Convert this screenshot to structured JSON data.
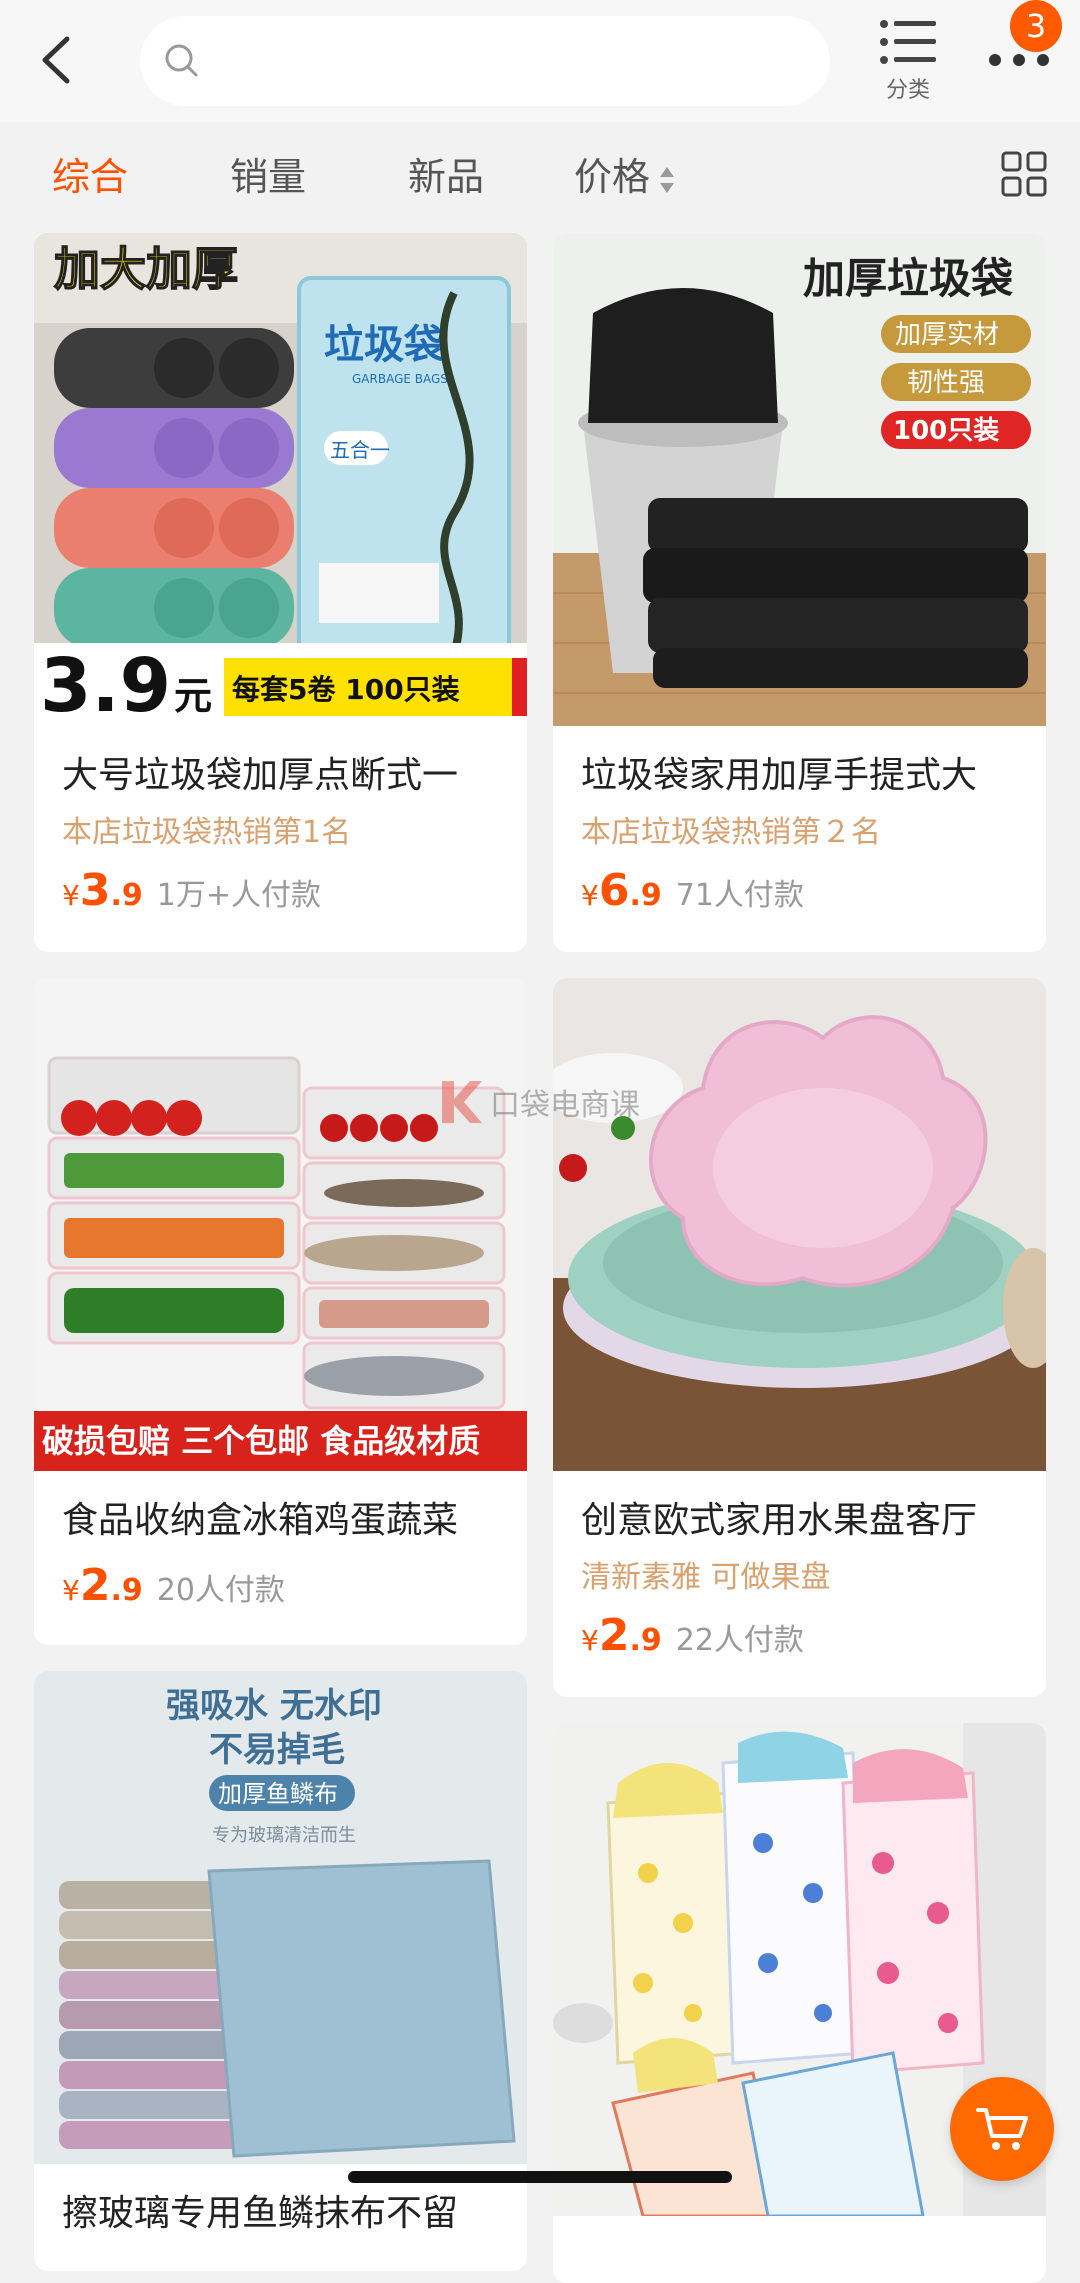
{
  "header": {
    "search_placeholder": "",
    "category_label": "分类",
    "notification_count": "3"
  },
  "sort_tabs": [
    {
      "label": "综合",
      "active": true
    },
    {
      "label": "销量",
      "active": false
    },
    {
      "label": "新品",
      "active": false
    },
    {
      "label": "价格",
      "active": false
    }
  ],
  "products": [
    {
      "title": "大号垃圾袋加厚点断式一",
      "tag": "本店垃圾袋热销第1名",
      "currency": "¥",
      "price_int": "3",
      "price_dec": ".9",
      "sold": "1万+人付款",
      "image": {
        "headline": "加大加厚",
        "package": "垃圾袋",
        "package_en": "GARBAGE BAGS",
        "five_in_one": "五合一",
        "big_price": "3.9",
        "big_price_unit": "元",
        "banner": "每套5卷 100只装"
      }
    },
    {
      "title": "垃圾袋家用加厚手提式大",
      "tag": "本店垃圾袋热销第２名",
      "currency": "¥",
      "price_int": "6",
      "price_dec": ".9",
      "sold": "71人付款",
      "image": {
        "headline": "加厚垃圾袋",
        "badge1": "加厚实材",
        "badge2": "韧性强",
        "badge3": "100只装"
      }
    },
    {
      "title": "食品收纳盒冰箱鸡蛋蔬菜",
      "tag": "",
      "currency": "¥",
      "price_int": "2",
      "price_dec": ".9",
      "sold": "20人付款",
      "image": {
        "banner": "破损包赔 三个包邮 食品级材质"
      }
    },
    {
      "title": "创意欧式家用水果盘客厅",
      "tag": "清新素雅 可做果盘",
      "currency": "¥",
      "price_int": "2",
      "price_dec": ".9",
      "sold": "22人付款",
      "image": {}
    },
    {
      "title": "擦玻璃专用鱼鳞抹布不留",
      "image": {
        "line1": "强吸水 无水印",
        "line2": "不易掉毛",
        "pill": "加厚鱼鳞布",
        "sub": "专为玻璃清洁而生"
      }
    },
    {
      "title": "",
      "image": {}
    }
  ],
  "watermark": "口袋电商课",
  "colors": {
    "accent": "#ff5000",
    "tag": "#d9a16e",
    "fab": "#ff6a00"
  }
}
